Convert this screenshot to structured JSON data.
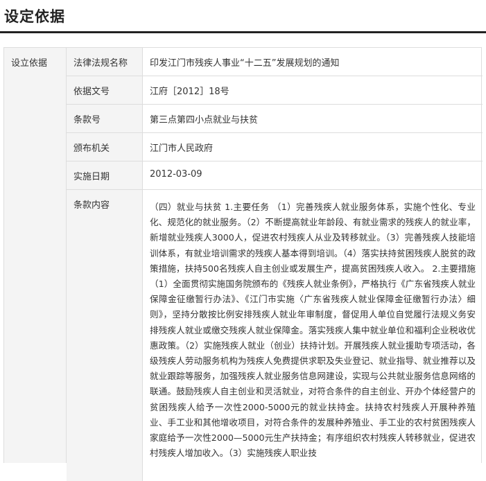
{
  "section": {
    "title": "设定依据"
  },
  "table": {
    "group_label": "设立依据",
    "rows": [
      {
        "label": "法律法规名称",
        "value": "印发江门市残疾人事业“十二五”发展规划的通知"
      },
      {
        "label": "依据文号",
        "value": "江府［2012］18号"
      },
      {
        "label": "条款号",
        "value": "第三点第四小点就业与扶贫"
      },
      {
        "label": "颁布机关",
        "value": "江门市人民政府"
      },
      {
        "label": "实施日期",
        "value": "2012-03-09"
      },
      {
        "label": "条款内容",
        "value": "（四）就业与扶贫 1.主要任务 （1）完善残疾人就业服务体系，实施个性化、专业化、规范化的就业服务。（2）不断提高就业年龄段、有就业需求的残疾人的就业率，新增就业残疾人3000人，促进农村残疾人从业及转移就业。（3）完善残疾人技能培训体系，有就业培训需求的残疾人基本得到培训。（4）落实扶持贫困残疾人脱贫的政策措施，扶持500名残疾人自主创业或发展生产，提高贫困残疾人收入。 2.主要措施 （1）全面贯彻实施国务院颁布的《残疾人就业条例》，严格执行《广东省残疾人就业保障金征缴暂行办法》、《江门市实施〈广东省残疾人就业保障金征缴暂行办法〉细则》，坚持分散按比例安排残疾人就业年审制度，督促用人单位自觉履行法规义务安排残疾人就业或缴交残疾人就业保障金。落实残疾人集中就业单位和福利企业税收优惠政策。（2）实施残疾人就业（创业）扶持计划。开展残疾人就业援助专项活动，各级残疾人劳动服务机构为残疾人免费提供求职及失业登记、就业指导、就业推荐以及就业跟踪等服务，加强残疾人就业服务信息网建设，实现与公共就业服务信息网络的联通。鼓励残疾人自主创业和灵活就业，对符合条件的自主创业、开办个体经营户的贫困残疾人给予一次性2000-5000元的就业扶持金。扶持农村残疾人开展种养殖业、手工业和其他增收项目，对符合条件的发展种养殖业、手工业的农村贫困残疾人家庭给予一次性2000—5000元生产扶持金；有序组织农村残疾人转移就业，促进农村残疾人增加收入。（3）实施残疾人职业技"
      }
    ]
  }
}
